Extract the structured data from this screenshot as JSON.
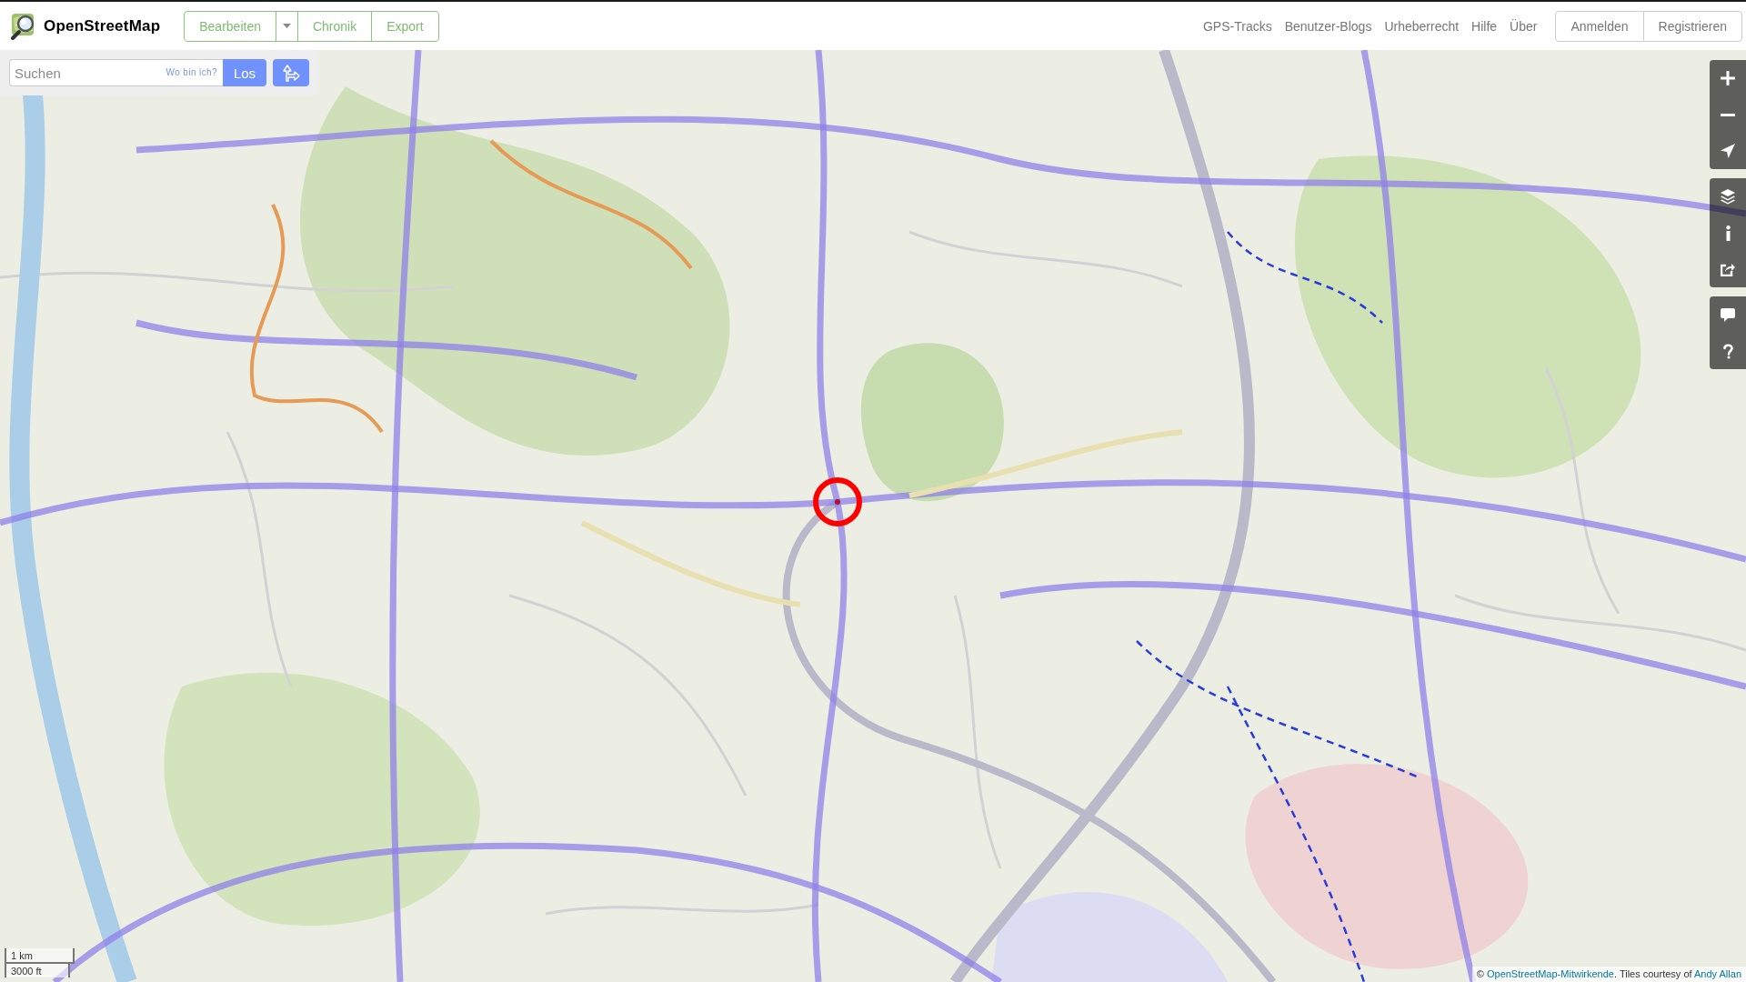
{
  "header": {
    "brand": "OpenStreetMap",
    "edit_group": [
      {
        "kind": "button",
        "label": "Bearbeiten"
      },
      {
        "kind": "menu-toggle"
      },
      {
        "kind": "button",
        "label": "Chronik"
      },
      {
        "kind": "button",
        "label": "Export"
      }
    ],
    "nav_links": [
      "GPS-Tracks",
      "Benutzer-Blogs",
      "Urheberrecht",
      "Hilfe",
      "Über"
    ],
    "account_buttons": [
      "Anmelden",
      "Registrieren"
    ]
  },
  "search": {
    "placeholder": "Suchen",
    "locate_link": "Wo bin ich?",
    "submit": "Los"
  },
  "map": {
    "scale": {
      "metric": "1 km",
      "imperial": "3000 ft"
    },
    "attribution": [
      {
        "kind": "text",
        "text": "© "
      },
      {
        "kind": "link",
        "text": "OpenStreetMap-Mitwirkende"
      },
      {
        "kind": "text",
        "text": ". Tiles courtesy of "
      },
      {
        "kind": "link",
        "text": "Andy Allan"
      }
    ]
  }
}
